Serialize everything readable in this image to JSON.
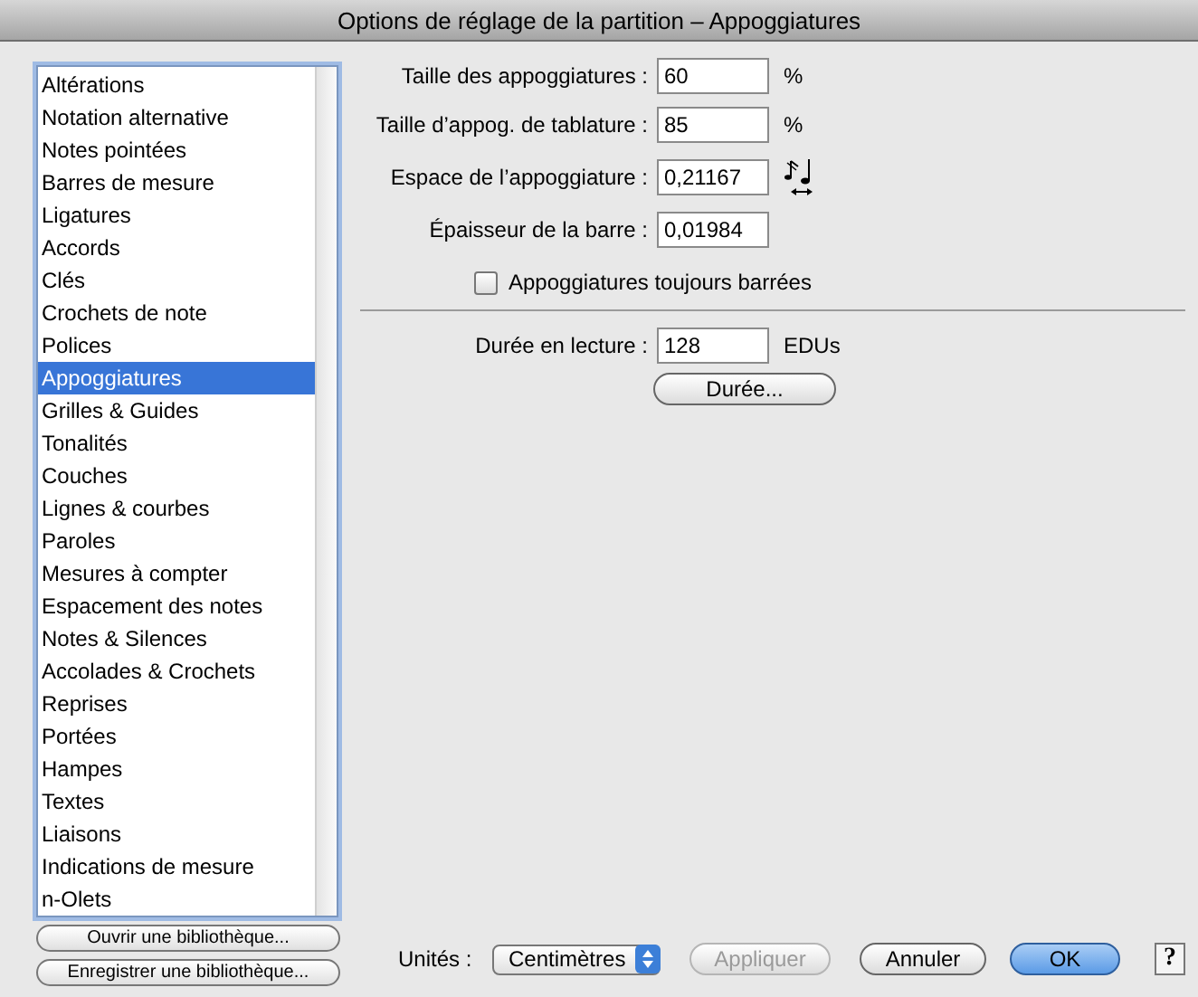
{
  "window": {
    "title": "Options de réglage de la partition – Appoggiatures"
  },
  "sidebar": {
    "items": [
      {
        "label": "Altérations",
        "selected": false
      },
      {
        "label": "Notation alternative",
        "selected": false
      },
      {
        "label": "Notes pointées",
        "selected": false
      },
      {
        "label": "Barres de mesure",
        "selected": false
      },
      {
        "label": "Ligatures",
        "selected": false
      },
      {
        "label": "Accords",
        "selected": false
      },
      {
        "label": "Clés",
        "selected": false
      },
      {
        "label": "Crochets de note",
        "selected": false
      },
      {
        "label": "Polices",
        "selected": false
      },
      {
        "label": "Appoggiatures",
        "selected": true
      },
      {
        "label": "Grilles & Guides",
        "selected": false
      },
      {
        "label": "Tonalités",
        "selected": false
      },
      {
        "label": "Couches",
        "selected": false
      },
      {
        "label": "Lignes & courbes",
        "selected": false
      },
      {
        "label": "Paroles",
        "selected": false
      },
      {
        "label": "Mesures à compter",
        "selected": false
      },
      {
        "label": "Espacement des notes",
        "selected": false
      },
      {
        "label": "Notes & Silences",
        "selected": false
      },
      {
        "label": "Accolades & Crochets",
        "selected": false
      },
      {
        "label": "Reprises",
        "selected": false
      },
      {
        "label": "Portées",
        "selected": false
      },
      {
        "label": "Hampes",
        "selected": false
      },
      {
        "label": "Textes",
        "selected": false
      },
      {
        "label": "Liaisons",
        "selected": false
      },
      {
        "label": "Indications de mesure",
        "selected": false
      },
      {
        "label": "n-Olets",
        "selected": false
      }
    ]
  },
  "library_buttons": [
    "Ouvrir une bibliothèque...",
    "Enregistrer une bibliothèque..."
  ],
  "fields": [
    {
      "kind": "unit",
      "label": "Taille des appoggiatures :",
      "value": "60",
      "unit": "%"
    },
    {
      "kind": "unit",
      "label": "Taille d’appog. de tablature :",
      "value": "85",
      "unit": "%"
    },
    {
      "kind": "spacing",
      "label": "Espace de l’appoggiature :",
      "value": "0,21167"
    },
    {
      "kind": "plain",
      "label": "Épaisseur de la barre :",
      "value": "0,01984"
    }
  ],
  "checkbox": {
    "label": "Appoggiatures toujours barrées",
    "checked": false
  },
  "playback": {
    "label": "Durée en lecture :",
    "value": "128",
    "unit": "EDUs",
    "button": "Durée..."
  },
  "units": {
    "label": "Unités :",
    "value": "Centimètres"
  },
  "buttons": [
    {
      "label": "Appliquer",
      "kind": "normal",
      "disabled": true
    },
    {
      "label": "Annuler",
      "kind": "normal",
      "disabled": false
    },
    {
      "label": "OK",
      "kind": "default",
      "disabled": false
    }
  ],
  "help": {
    "label": "?"
  }
}
